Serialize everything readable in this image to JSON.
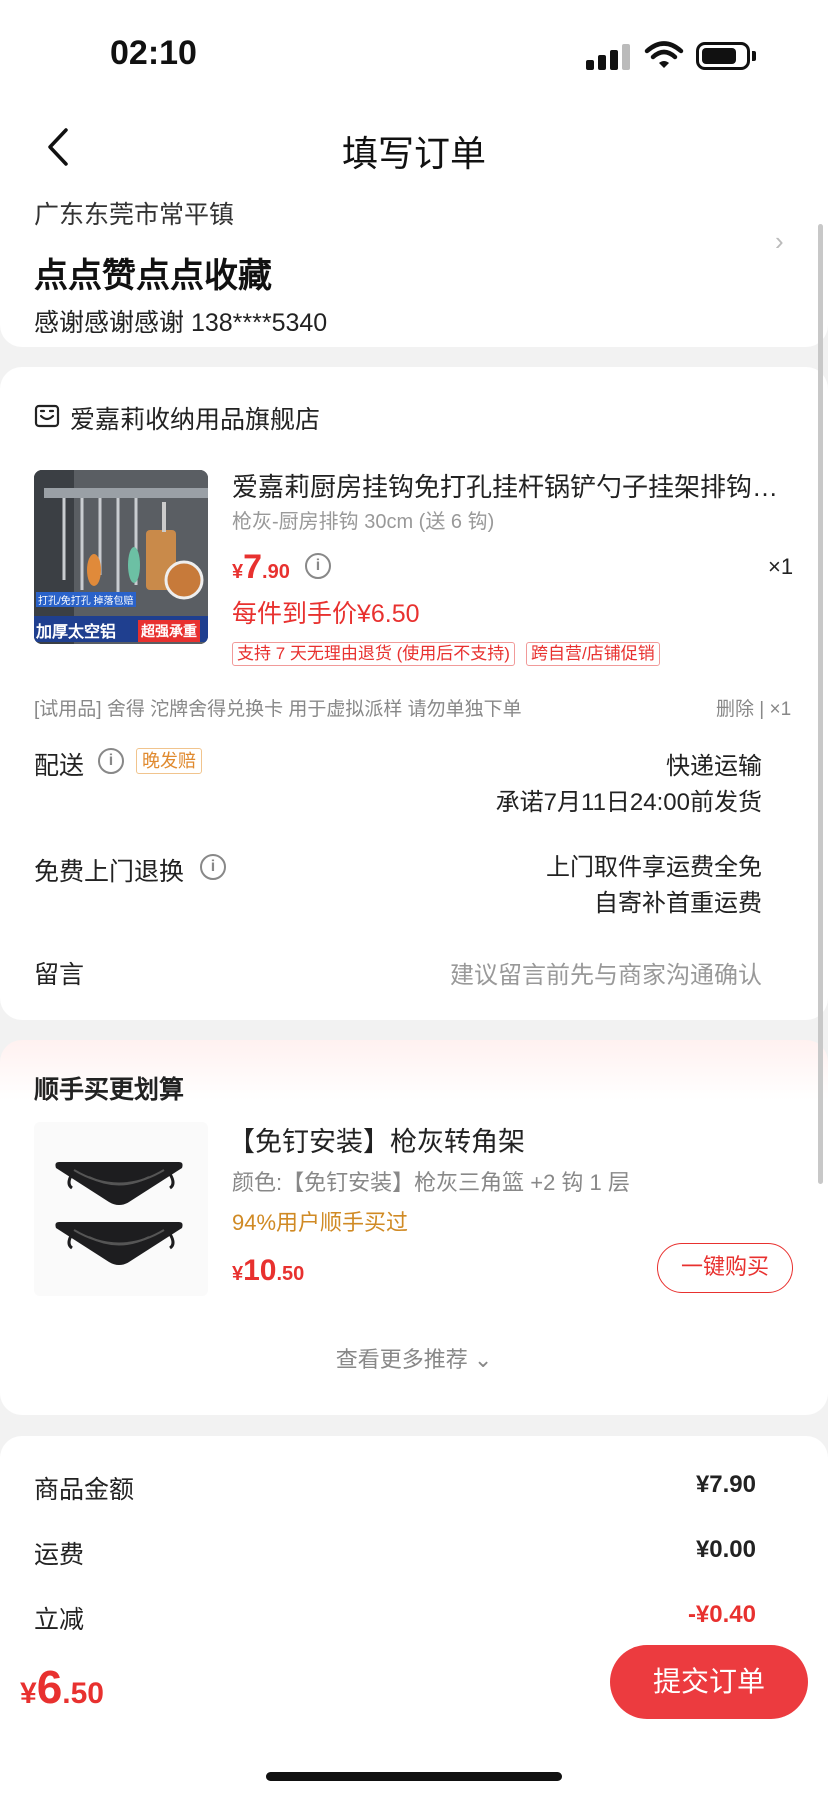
{
  "status_bar": {
    "time": "02:10"
  },
  "header": {
    "title": "填写订单"
  },
  "address": {
    "region": "广东东莞市常平镇",
    "detail": "点点赞点点收藏",
    "contact": "感谢感谢感谢  138****5340"
  },
  "store": {
    "name": "爱嘉莉收纳用品旗舰店"
  },
  "product": {
    "title": "爱嘉莉厨房挂钩免打孔挂杆锅铲勺子挂架排钩壁挂件",
    "spec": "枪灰-厨房排钩 30cm (送 6 钩)",
    "price_symbol": "¥",
    "price_int": "7",
    "price_dec": ".90",
    "quantity": "×1",
    "final_price": "每件到手价¥6.50",
    "tags": [
      "支持 7 天无理由退货 (使用后不支持)",
      "跨自营/店铺促销"
    ],
    "image_caption_small": "打孔/免打孔 掉落包赔",
    "image_caption_main": "加厚太空铝",
    "image_caption_badge": "超强承重"
  },
  "gift": {
    "text": "[试用品]  舍得  沱牌舍得兑换卡  用于虚拟派样  请勿单独下单",
    "action": "删除  |  ×1"
  },
  "delivery": {
    "label": "配送",
    "tag": "晚发赔",
    "method": "快递运输",
    "promise": "承诺7月11日24:00前发货"
  },
  "return_service": {
    "label": "免费上门退换",
    "line1": "上门取件享运费全免",
    "line2": "自寄补首重运费"
  },
  "remark": {
    "label": "留言",
    "placeholder": "建议留言前先与商家沟通确认"
  },
  "recommend": {
    "title": "顺手买更划算",
    "item_name": "【免钉安装】枪灰转角架",
    "item_spec": "颜色:【免钉安装】枪灰三角篮 +2 钩 1 层",
    "item_bought": "94%用户顺手买过",
    "price_symbol": "¥",
    "price_int": "10",
    "price_dec": ".50",
    "buy_label": "一键购买",
    "more_label": "查看更多推荐 ⌄"
  },
  "summary": {
    "goods_label": "商品金额",
    "goods_value": "¥7.90",
    "shipping_label": "运费",
    "shipping_value": "¥0.00",
    "discount_label": "立减",
    "discount_value": "-¥0.40"
  },
  "footer": {
    "total_symbol": "¥",
    "total_int": "6",
    "total_dec": ".50",
    "submit_label": "提交订单"
  },
  "colors": {
    "accent": "#e8312f",
    "button": "#ec3b3f",
    "orange": "#d08a24"
  }
}
